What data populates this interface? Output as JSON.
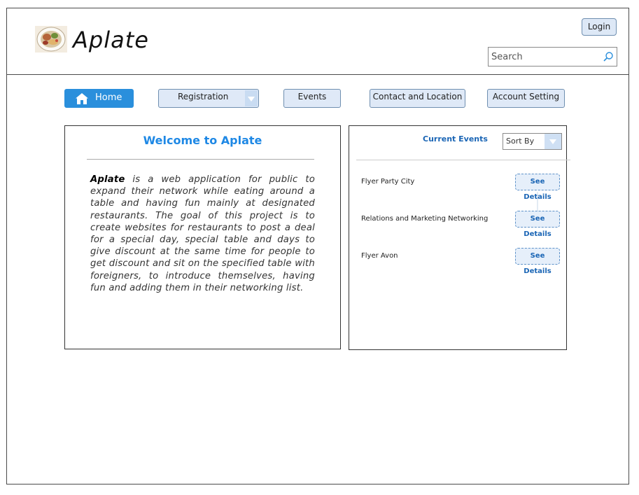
{
  "header": {
    "app_title": "Aplate",
    "login_label": "Login",
    "search": {
      "placeholder": "Search",
      "value": ""
    }
  },
  "nav": {
    "items": [
      {
        "label": "Home",
        "active": true,
        "icon": "home-icon"
      },
      {
        "label": "Registration",
        "has_dropdown": true
      },
      {
        "label": "Events"
      },
      {
        "label": "Contact and Location"
      },
      {
        "label": "Account Setting"
      }
    ]
  },
  "welcome": {
    "title": "Welcome to Aplate",
    "brand_word": "Aplate",
    "body": "is a web application for public to expand their network while eating around a table and having fun mainly at designated restaurants. The goal of this project is to create websites for restaurants to post a deal for a special day, special table and days to give discount at the same time for people to get discount and sit on the specified table with foreigners, to introduce themselves, having fun and adding them in their networking list."
  },
  "events": {
    "title": "Current Events",
    "sort_label": "Sort By",
    "items": [
      {
        "name": "Flyer Party City",
        "button": "See Details"
      },
      {
        "name": "Relations and Marketing Networking",
        "button": "See Details"
      },
      {
        "name": "Flyer Avon",
        "button": "See Details"
      }
    ]
  },
  "colors": {
    "accent": "#2a8fdc",
    "title_blue": "#1e88e5",
    "button_bg": "#dfe9f7",
    "link_blue": "#1a65b5"
  }
}
